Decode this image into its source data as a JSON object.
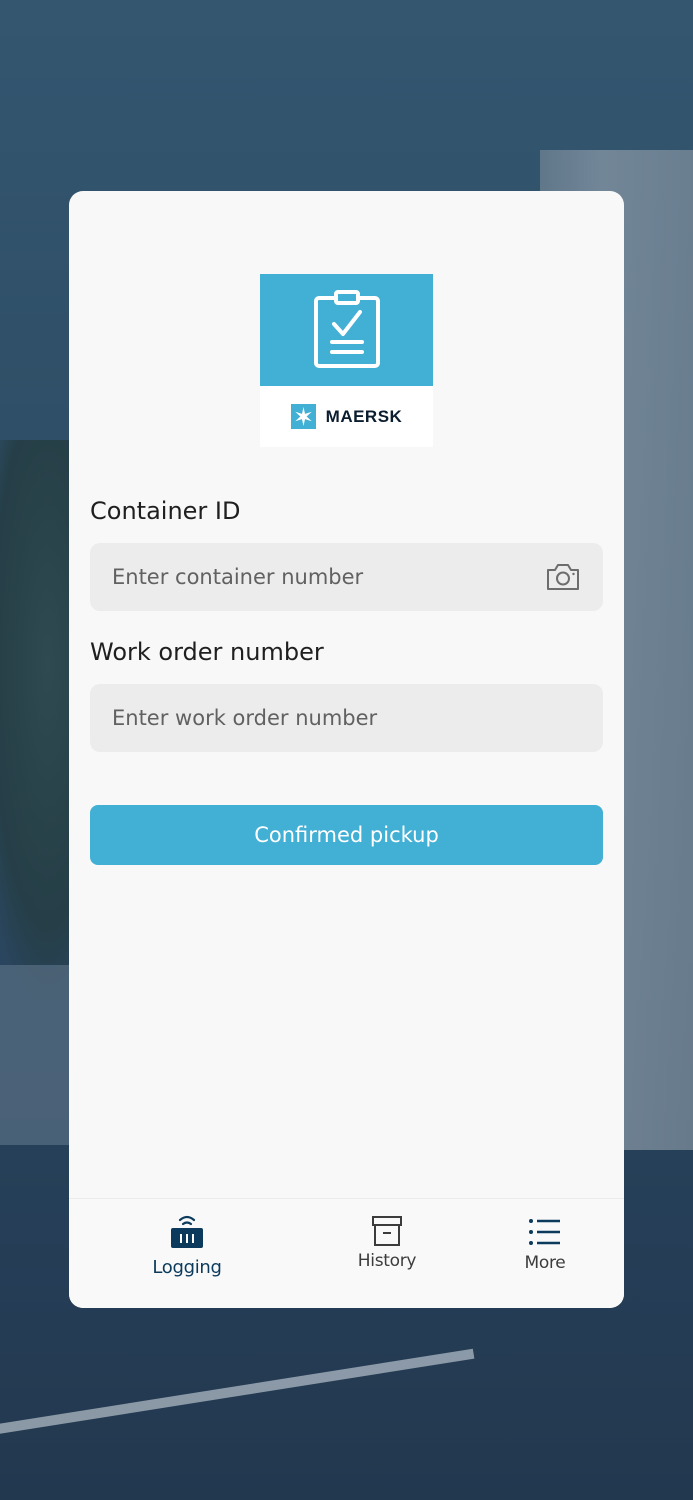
{
  "logo": {
    "brand": "MAERSK",
    "icon": "clipboard-check-icon"
  },
  "form": {
    "container_label": "Container ID",
    "container_placeholder": "Enter container number",
    "work_order_label": "Work order number",
    "work_order_placeholder": "Enter work order number",
    "submit_label": "Confirmed pickup"
  },
  "nav": {
    "items": [
      {
        "label": "Logging",
        "icon": "logging-icon",
        "active": true
      },
      {
        "label": "History",
        "icon": "archive-box-icon",
        "active": false
      },
      {
        "label": "More",
        "icon": "list-icon",
        "active": false
      }
    ]
  },
  "colors": {
    "accent": "#42b0d5",
    "nav_active": "#0b3a5c",
    "nav_inactive": "#3c3c3c"
  }
}
